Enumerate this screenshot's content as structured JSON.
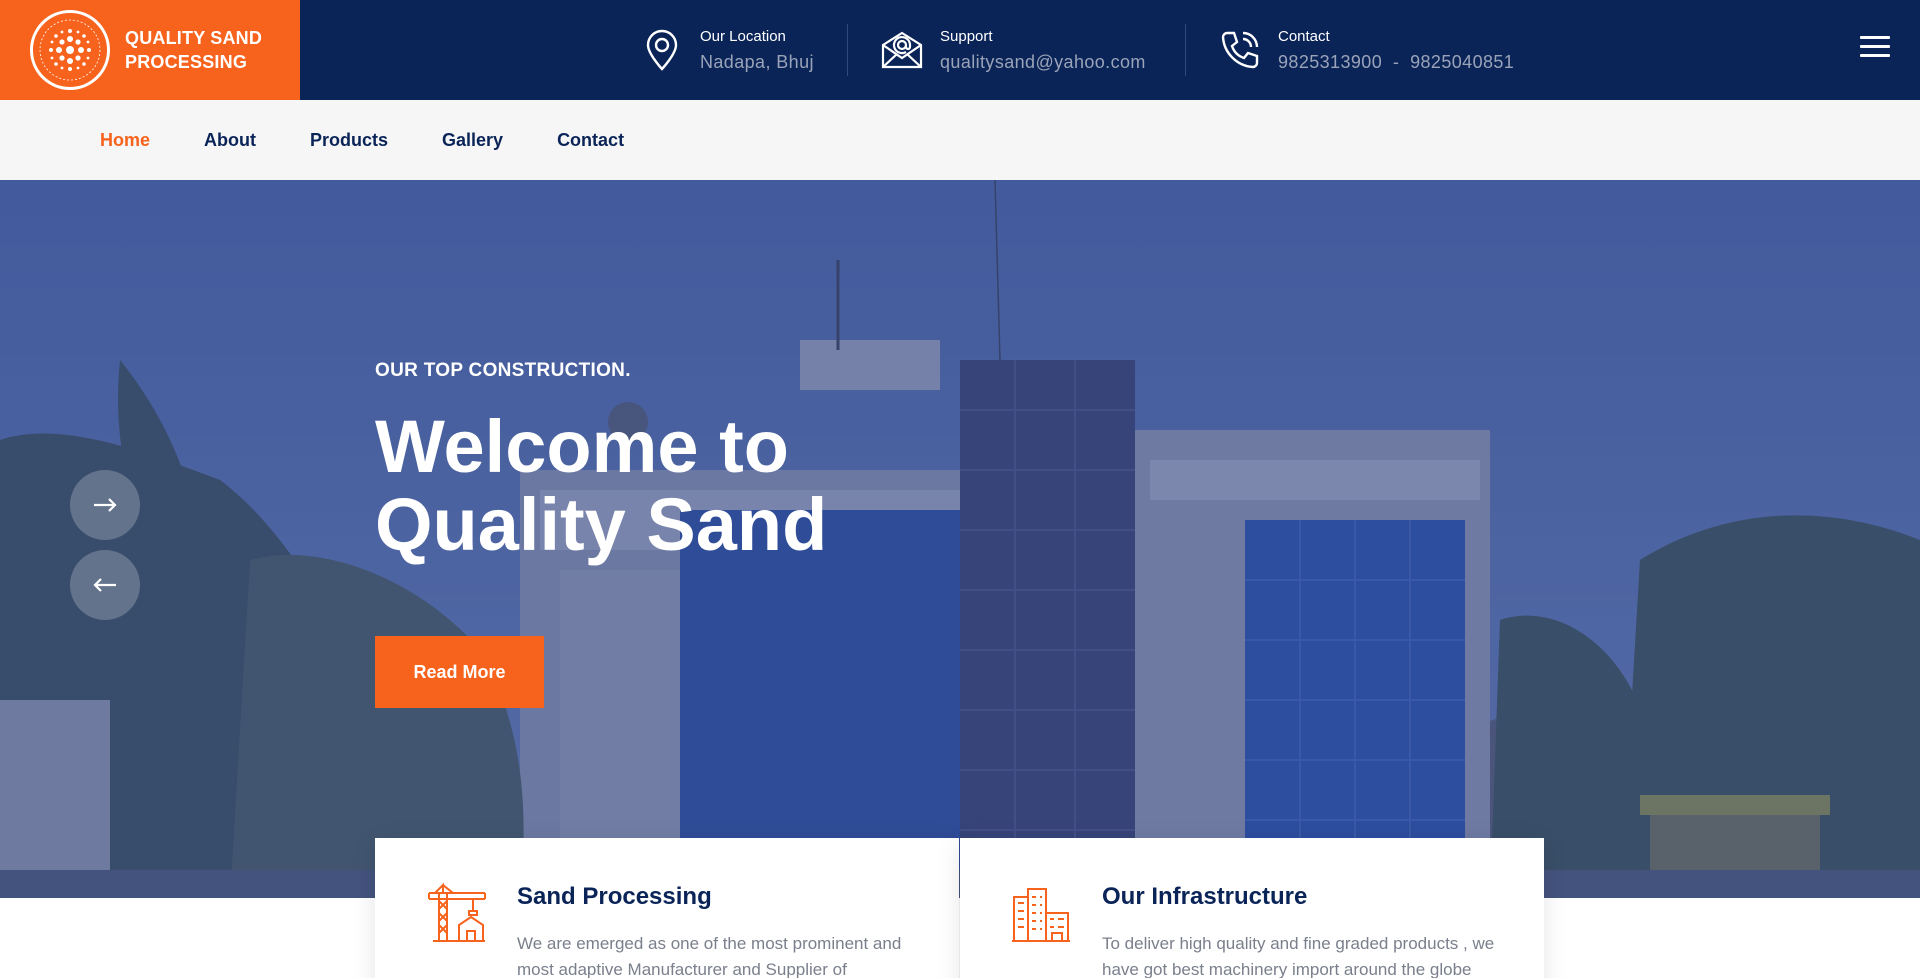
{
  "brand": {
    "name": "QUALITY SAND PROCESSING",
    "logo_ring_text": "QUALITY SAND PROCESSING PRIVATE LIMITED"
  },
  "header": {
    "location": {
      "label": "Our Location",
      "value": "Nadapa, Bhuj",
      "icon": "map-pin-icon"
    },
    "support": {
      "label": "Support",
      "value": "qualitysand@yahoo.com",
      "icon": "envelope-icon"
    },
    "contact": {
      "label": "Contact",
      "value": "9825313900  -  9825040851",
      "icon": "phone-icon"
    },
    "menu_icon": "hamburger-icon"
  },
  "nav": {
    "items": [
      {
        "label": "Home",
        "active": true
      },
      {
        "label": "About",
        "active": false
      },
      {
        "label": "Products",
        "active": false
      },
      {
        "label": "Gallery",
        "active": false
      },
      {
        "label": "Contact",
        "active": false
      }
    ]
  },
  "hero": {
    "eyebrow": "OUR TOP CONSTRUCTION.",
    "title": "Welcome to Quality Sand",
    "button": "Read More",
    "next_icon": "arrow-right-icon",
    "prev_icon": "arrow-left-icon"
  },
  "cards": [
    {
      "title": "Sand Processing",
      "text": "We are emerged as one of the most prominent and most adaptive Manufacturer and Supplier of",
      "icon": "crane-icon"
    },
    {
      "title": "Our Infrastructure",
      "text": "To deliver high quality and fine graded products , we have got best machinery import around the globe",
      "icon": "factory-icon"
    }
  ],
  "colors": {
    "accent": "#f7621c",
    "navy": "#0a2458",
    "nav_bg": "#f6f6f6"
  }
}
